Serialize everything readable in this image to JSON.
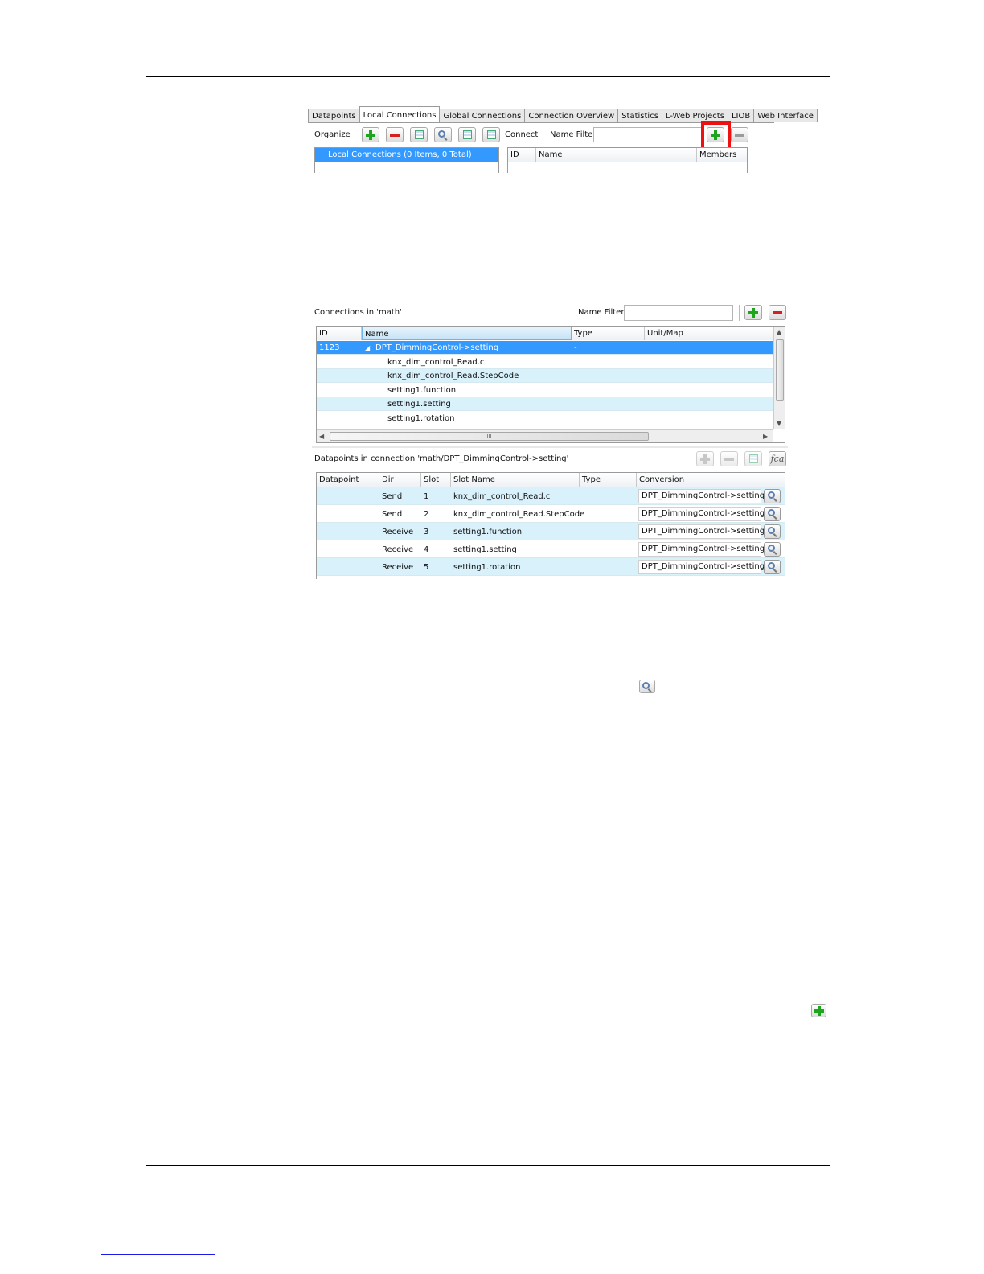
{
  "local_connections_view": {
    "tabs": [
      "Datapoints",
      "Local Connections",
      "Global Connections",
      "Connection Overview",
      "Statistics",
      "L-Web Projects",
      "LIOB",
      "Web Interface"
    ],
    "active_tab": "Local Connections",
    "organize_label": "Organize",
    "connect_label": "Connect",
    "name_filter_label": "Name Filter",
    "name_filter_value": "",
    "tree_item": "Local Connections (0 Items, 0 Total)",
    "columns": [
      "ID",
      "Name",
      "Members"
    ]
  },
  "connections_view": {
    "title": "Connections in 'math'",
    "name_filter_label": "Name Filter",
    "name_filter_value": "",
    "columns": [
      "ID",
      "Name",
      "Type",
      "Unit/Map"
    ],
    "rows": [
      {
        "id": "1123",
        "name": "DPT_DimmingControl->setting",
        "type": "-",
        "unit": "",
        "selected": true
      },
      {
        "id": "",
        "name": "knx_dim_control_Read.c",
        "type": "",
        "unit": ""
      },
      {
        "id": "",
        "name": "knx_dim_control_Read.StepCode",
        "type": "",
        "unit": ""
      },
      {
        "id": "",
        "name": "setting1.function",
        "type": "",
        "unit": ""
      },
      {
        "id": "",
        "name": "setting1.setting",
        "type": "",
        "unit": ""
      },
      {
        "id": "",
        "name": "setting1.rotation",
        "type": "",
        "unit": ""
      }
    ],
    "hscroll_grip": "III"
  },
  "datapoints_view": {
    "title": "Datapoints in connection 'math/DPT_DimmingControl->setting'",
    "fx_label": "fca",
    "columns": [
      "Datapoint",
      "Dir",
      "Slot",
      "Slot Name",
      "Type",
      "Conversion"
    ],
    "rows": [
      {
        "datapoint": "",
        "dir": "Send",
        "slot": "1",
        "slot_name": "knx_dim_control_Read.c",
        "type": "",
        "conversion": "DPT_DimmingControl->setting"
      },
      {
        "datapoint": "",
        "dir": "Send",
        "slot": "2",
        "slot_name": "knx_dim_control_Read.StepCode",
        "type": "",
        "conversion": "DPT_DimmingControl->setting"
      },
      {
        "datapoint": "",
        "dir": "Receive",
        "slot": "3",
        "slot_name": "setting1.function",
        "type": "",
        "conversion": "DPT_DimmingControl->setting"
      },
      {
        "datapoint": "",
        "dir": "Receive",
        "slot": "4",
        "slot_name": "setting1.setting",
        "type": "",
        "conversion": "DPT_DimmingControl->setting"
      },
      {
        "datapoint": "",
        "dir": "Receive",
        "slot": "5",
        "slot_name": "setting1.rotation",
        "type": "",
        "conversion": "DPT_DimmingControl->setting"
      }
    ]
  },
  "colors": {
    "selection": "#3399ff",
    "alt_row": "#d8f1fb",
    "highlight_box": "#ee1111",
    "add_icon": "#1ea51e",
    "remove_icon": "#d42020"
  }
}
